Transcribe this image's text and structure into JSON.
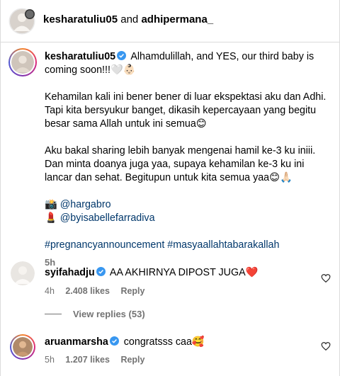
{
  "header": {
    "user1": "kesharatuliu05",
    "joiner": "and",
    "user2": "adhipermana_"
  },
  "post": {
    "username": "kesharatuliu05",
    "line1": "Alhamdulillah, and YES, our third baby is",
    "line2": "coming soon!!!🤍👶🏻",
    "p2_l1": "Kehamilan kali ini bener bener di luar ekspektasi aku dan Adhi.",
    "p2_l2": "Tapi kita bersyukur banget, dikasih kepercayaan yang begitu",
    "p2_l3": "besar sama Allah untuk ini semua😊",
    "p3_l1": "Aku bakal sharing lebih banyak mengenai hamil ke-3 ku iniii.",
    "p3_l2": "Dan minta doanya juga yaa, supaya kehamilan ke-3 ku ini",
    "p3_l3": "lancar dan sehat. Begitupun untuk kita semua yaa😊🙏🏻",
    "credit1_icon": "📸",
    "credit1": "@hargabro",
    "credit2_icon": "💄",
    "credit2": "@byisabellefarradiva",
    "hashtags": "#pregnancyannouncement #masyaallahtabarakallah",
    "time": "5h"
  },
  "comments": [
    {
      "username": "syifahadju",
      "text": "AA AKHIRNYA DIPOST JUGA❤️",
      "time": "4h",
      "likes": "2.408 likes",
      "reply": "Reply"
    },
    {
      "username": "aruanmarsha",
      "text": "congratsss caa🥰",
      "time": "5h",
      "likes": "1.207 likes",
      "reply": "Reply"
    }
  ],
  "view_replies": "View replies (53)",
  "colors": {
    "verified": "#3897f0",
    "link": "#00376b",
    "muted": "#737373",
    "divider": "#dbdbdb"
  }
}
